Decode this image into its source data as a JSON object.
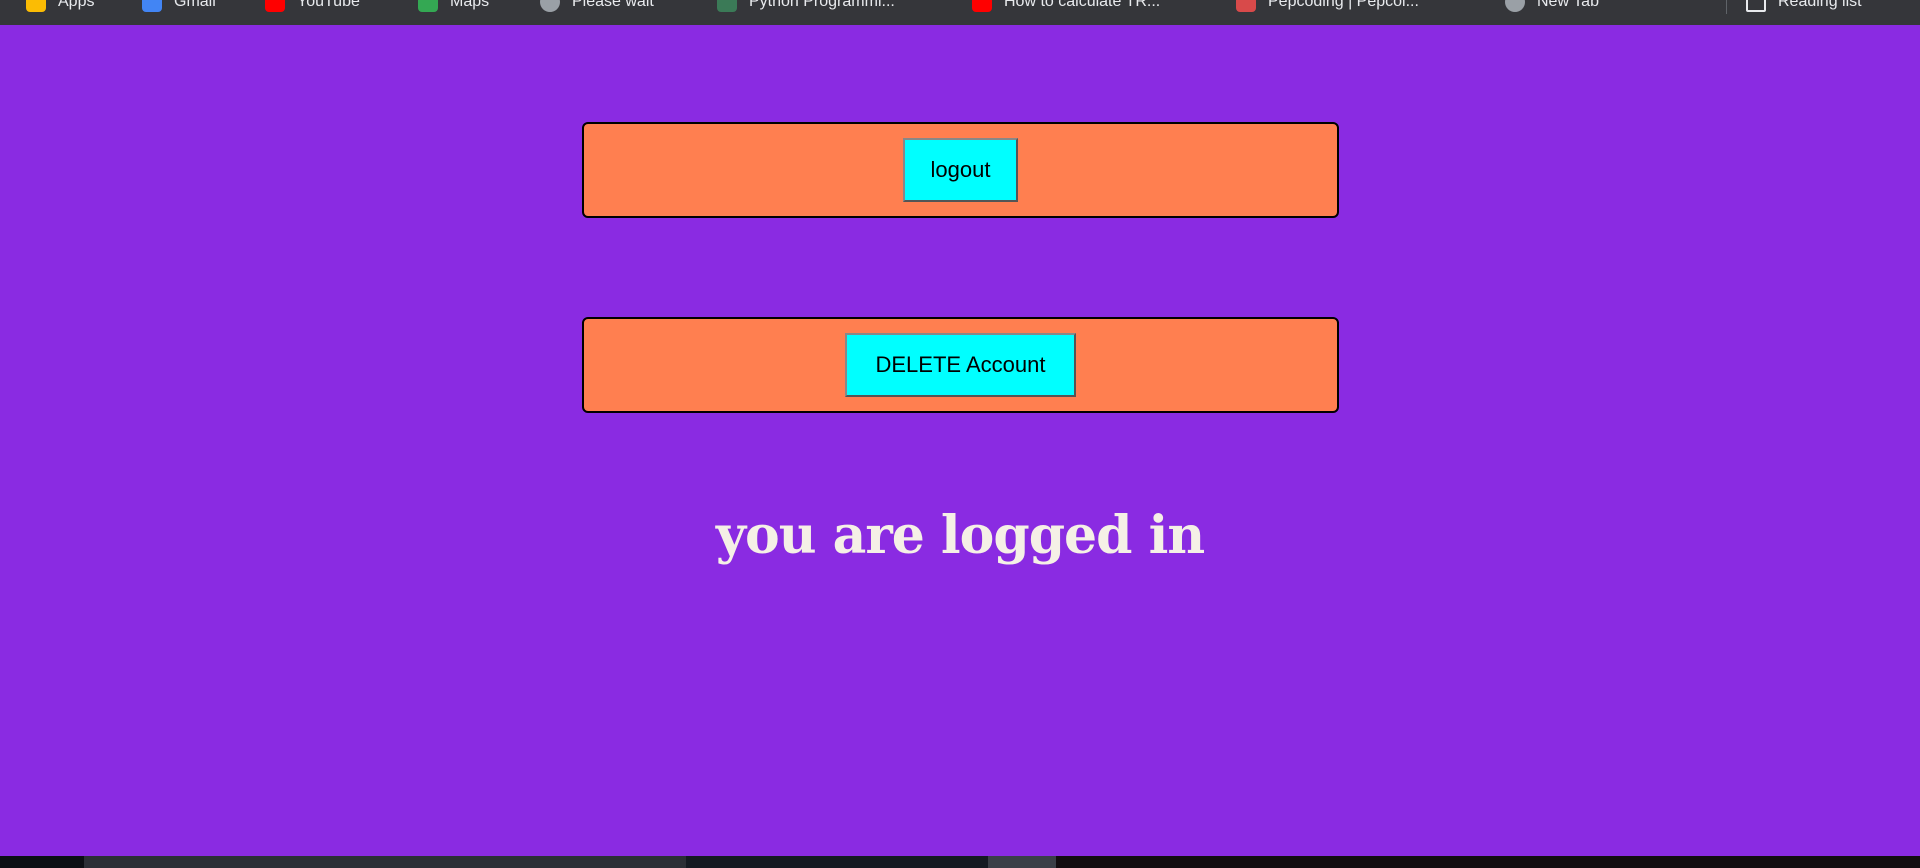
{
  "bookmarks": [
    {
      "label": "Apps",
      "icon": "apps-grid-icon",
      "color": "#fbbc04"
    },
    {
      "label": "Gmail",
      "icon": "gmail-icon",
      "color": "#4285f4"
    },
    {
      "label": "YouTube",
      "icon": "youtube-icon",
      "color": "#ff0000"
    },
    {
      "label": "Maps",
      "icon": "maps-icon",
      "color": "#34a853"
    },
    {
      "label": "Please wait",
      "icon": "globe-icon",
      "color": "#9aa0a6"
    },
    {
      "label": "Python Programmi...",
      "icon": "python-icon",
      "color": "#3b7a57"
    },
    {
      "label": "How to calculate TR...",
      "icon": "youtube-icon",
      "color": "#ff0000"
    },
    {
      "label": "Pepcoding | Pepcoi...",
      "icon": "pepcoding-icon",
      "color": "#d84a4a"
    },
    {
      "label": "New Tab",
      "icon": "globe-icon",
      "color": "#9aa0a6"
    }
  ],
  "reading_list": {
    "label": "Reading list",
    "icon": "reading-list-icon"
  },
  "actions": {
    "logout_label": "logout",
    "delete_label": "DELETE Account"
  },
  "status": {
    "message": "you are logged in"
  },
  "colors": {
    "page_background": "#8a2be2",
    "panel_background": "#ff7f50",
    "button_background": "#00ffff",
    "message_text": "#f5f0e6"
  }
}
